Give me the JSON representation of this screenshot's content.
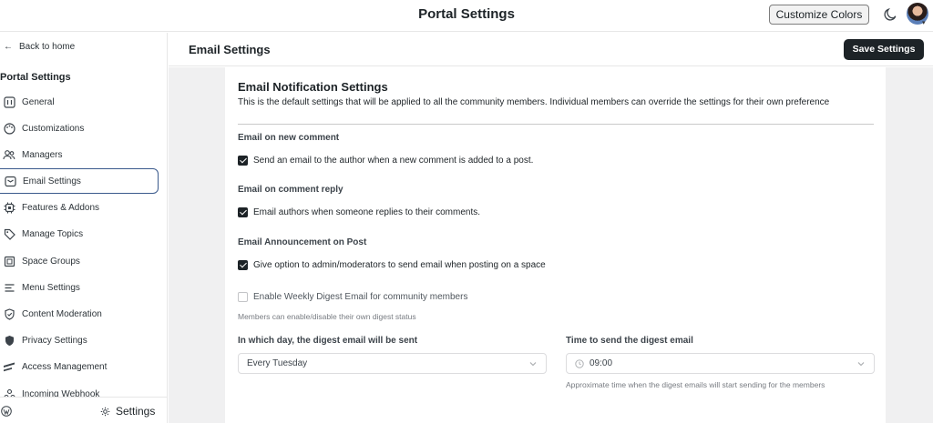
{
  "topbar": {
    "title": "Portal Settings",
    "customize_label": "Customize Colors"
  },
  "sidebar": {
    "back_label": "Back to home",
    "heading": "Portal Settings",
    "items": [
      {
        "label": "General",
        "icon": "general-icon"
      },
      {
        "label": "Customizations",
        "icon": "palette-icon"
      },
      {
        "label": "Managers",
        "icon": "users-icon"
      },
      {
        "label": "Email Settings",
        "icon": "mail-icon",
        "active": true
      },
      {
        "label": "Features & Addons",
        "icon": "chip-icon"
      },
      {
        "label": "Manage Topics",
        "icon": "tag-icon"
      },
      {
        "label": "Space Groups",
        "icon": "layers-icon"
      },
      {
        "label": "Menu Settings",
        "icon": "menu-icon"
      },
      {
        "label": "Content Moderation",
        "icon": "shield-check-icon"
      },
      {
        "label": "Privacy Settings",
        "icon": "shield-icon"
      },
      {
        "label": "Access Management",
        "icon": "access-icon"
      },
      {
        "label": "Incoming Webhook",
        "icon": "webhook-icon"
      }
    ],
    "footer_settings_label": "Settings"
  },
  "main": {
    "header_title": "Email Settings",
    "save_label": "Save Settings",
    "card": {
      "title": "Email Notification Settings",
      "description": "This is the default settings that will be applied to all the community members. Individual members can override the settings for their own preference",
      "sections": [
        {
          "label": "Email on new comment",
          "checkbox": "Send an email to the author when a new comment is added to a post.",
          "checked": true
        },
        {
          "label": "Email on comment reply",
          "checkbox": "Email authors when someone replies to their comments.",
          "checked": true
        },
        {
          "label": "Email Announcement on Post",
          "checkbox": "Give option to admin/moderators to send email when posting on a space",
          "checked": true
        }
      ],
      "digest": {
        "checkbox": "Enable Weekly Digest Email for community members",
        "checked": false,
        "hint": "Members can enable/disable their own digest status",
        "day_label": "In which day, the digest email will be sent",
        "day_value": "Every Tuesday",
        "time_label": "Time to send the digest email",
        "time_value": "09:00",
        "time_hint": "Approximate time when the digest emails will start sending for the members"
      }
    }
  },
  "colors": {
    "accent_dark": "#1d2327",
    "active_border": "#3b5a8c",
    "canvas_bg": "#f0f0f1"
  }
}
